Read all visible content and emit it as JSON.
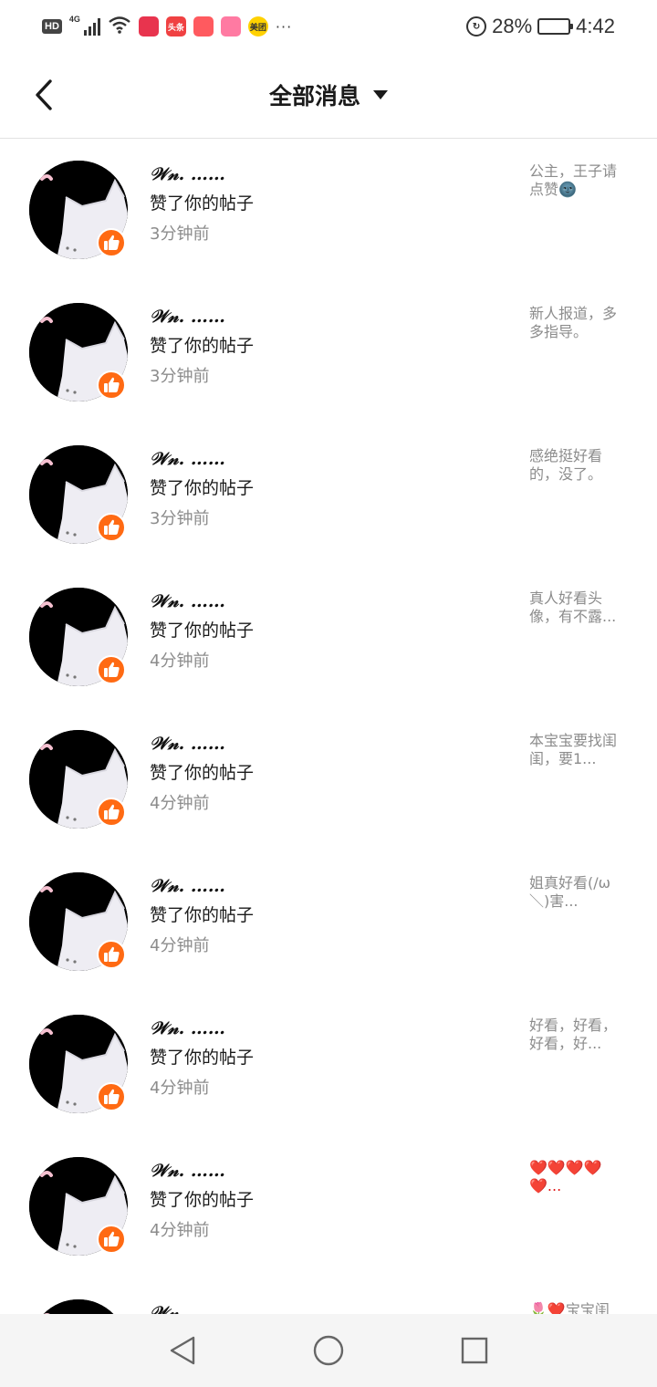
{
  "status_bar": {
    "hd": "HD",
    "network": "4G",
    "apps": [
      {
        "name": "app-icon-1",
        "label": "",
        "color": "#e8344e"
      },
      {
        "name": "app-icon-toutiao",
        "label": "头条",
        "color": "#f04142"
      },
      {
        "name": "app-icon-map",
        "label": "",
        "color": "#ff5a5f"
      },
      {
        "name": "app-icon-video",
        "label": "",
        "color": "#ff7aa2"
      },
      {
        "name": "app-icon-meituan",
        "label": "美团",
        "color": "#ffd100"
      }
    ],
    "more": "···",
    "battery": "28%",
    "battery_level": 0.28,
    "time": "4:42"
  },
  "header": {
    "title": "全部消息"
  },
  "messages": [
    {
      "username": "𝒲𝓃. ……",
      "action": "赞了你的帖子",
      "time": "3分钟前",
      "preview": "公主，王子请点赞🌚"
    },
    {
      "username": "𝒲𝓃. ……",
      "action": "赞了你的帖子",
      "time": "3分钟前",
      "preview": "新人报道，多多指导。"
    },
    {
      "username": "𝒲𝓃. ……",
      "action": "赞了你的帖子",
      "time": "3分钟前",
      "preview": "感绝挺好看的，没了。"
    },
    {
      "username": "𝒲𝓃. ……",
      "action": "赞了你的帖子",
      "time": "4分钟前",
      "preview": "真人好看头像，有不露..."
    },
    {
      "username": "𝒲𝓃. ……",
      "action": "赞了你的帖子",
      "time": "4分钟前",
      "preview": "本宝宝要找闺闺，要1..."
    },
    {
      "username": "𝒲𝓃. ……",
      "action": "赞了你的帖子",
      "time": "4分钟前",
      "preview": "姐真好看(/ω＼)害..."
    },
    {
      "username": "𝒲𝓃. ……",
      "action": "赞了你的帖子",
      "time": "4分钟前",
      "preview": "好看，好看，好看，好..."
    },
    {
      "username": "𝒲𝓃. ……",
      "action": "赞了你的帖子",
      "time": "4分钟前",
      "preview": "❤️❤️❤️❤️❤️..."
    },
    {
      "username": "𝒲𝓃. ……",
      "action": "",
      "time": "",
      "preview": "🌷❤️宝宝闺"
    }
  ],
  "colors": {
    "accent": "#ff6a13",
    "secondary_text": "#8c8c8c"
  }
}
